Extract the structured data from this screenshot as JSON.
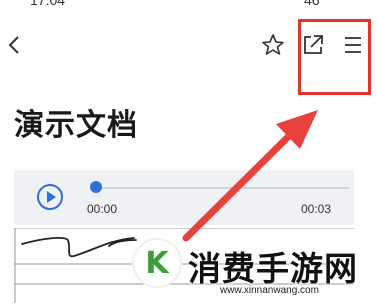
{
  "status_bar": {
    "time": "17:04",
    "battery": "46"
  },
  "nav": {
    "back_icon": "chevron-left-icon",
    "favorite_icon": "star-icon",
    "share_icon": "share-icon",
    "menu_icon": "menu-icon",
    "highlight_color": "#e0342f"
  },
  "document": {
    "title": "演示文档"
  },
  "audio": {
    "current_time": "00:00",
    "total_time": "00:03",
    "progress": 0,
    "accent": "#2f6fd8"
  },
  "watermark": {
    "text": "消费手游网",
    "url": "www.xinnanwang.com",
    "logo_letter": "K"
  }
}
